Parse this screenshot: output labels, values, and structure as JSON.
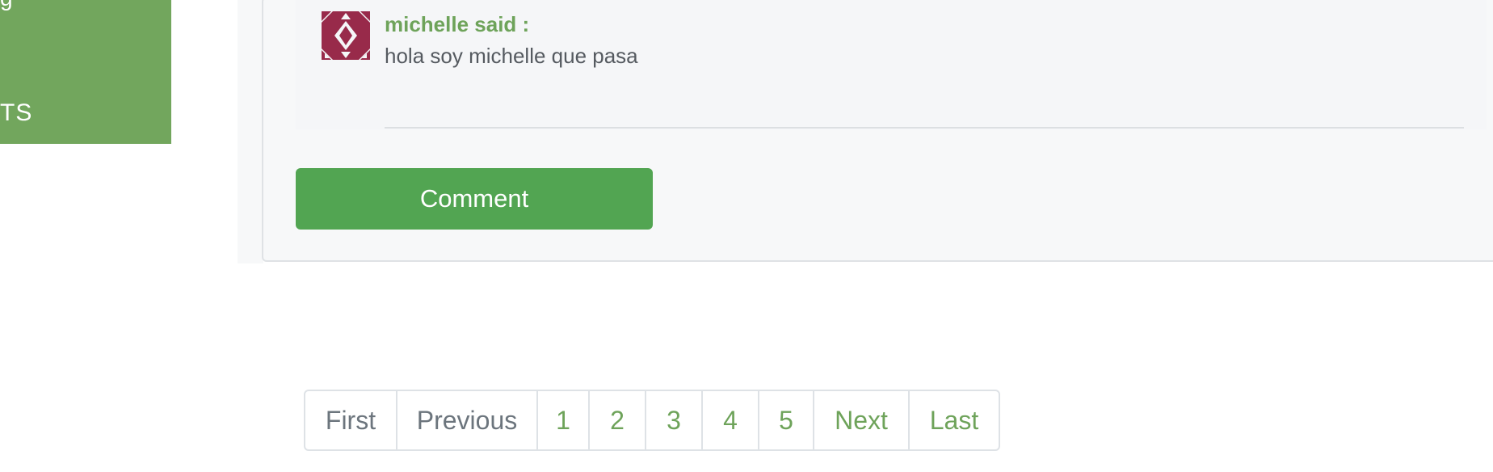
{
  "sidebar": {
    "top_label": "g",
    "item_label": "TS"
  },
  "comment": {
    "author": "michelle said :",
    "text": "hola soy michelle que pasa",
    "avatar_color": "#982a4a"
  },
  "comment_button": {
    "label": "Comment"
  },
  "pagination": {
    "first": "First",
    "previous": "Previous",
    "pages": [
      "1",
      "2",
      "3",
      "4",
      "5"
    ],
    "next": "Next",
    "last": "Last"
  },
  "colors": {
    "sidebar_green": "#72a65d",
    "button_green": "#52a552",
    "link_green": "#6ea35a",
    "disabled_gray": "#6c757d"
  }
}
